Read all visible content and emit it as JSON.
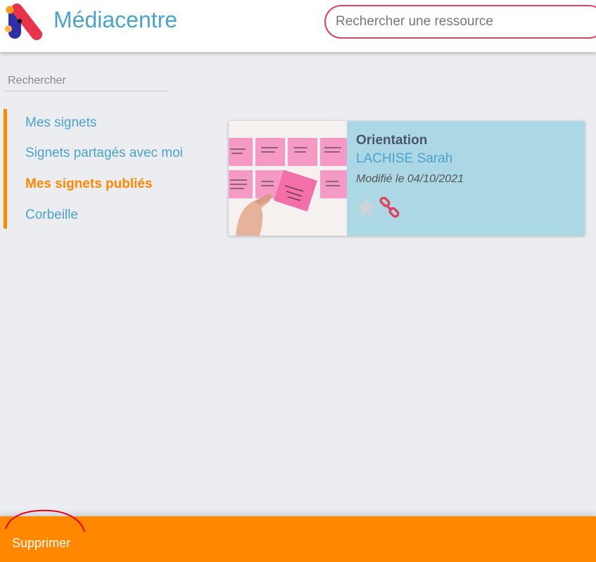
{
  "header": {
    "app_title": "Médiacentre",
    "search_placeholder": "Rechercher une ressource",
    "accent_color": "#e0435d"
  },
  "sidebar": {
    "search_placeholder": "Rechercher",
    "items": [
      {
        "label": "Mes signets",
        "active": false
      },
      {
        "label": "Signets partagés avec moi",
        "active": false
      },
      {
        "label": "Mes signets publiés",
        "active": true
      },
      {
        "label": "Corbeille",
        "active": false
      }
    ],
    "active_color": "#ff8800",
    "link_color": "#4aa3cc"
  },
  "card": {
    "title": "Orientation",
    "author": "LACHISE Sarah",
    "date": "Modifié le 04/10/2021",
    "favorite_icon": "star-icon",
    "link_icon": "link-icon",
    "image": "sticky-notes-photo",
    "background": "#acd8e6"
  },
  "footer": {
    "delete_label": "Supprimer",
    "background": "#ff8800"
  }
}
